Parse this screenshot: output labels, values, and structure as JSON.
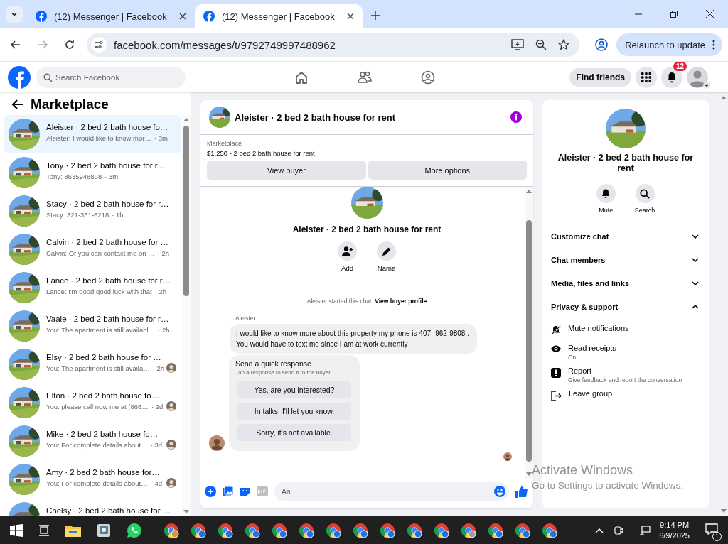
{
  "browser": {
    "tabs": [
      {
        "title": "(12) Messenger | Facebook",
        "selected": false
      },
      {
        "title": "(12) Messenger | Facebook",
        "selected": true
      }
    ],
    "url": "facebook.com/messages/t/9792749997488962",
    "relaunch": "Relaunch to update"
  },
  "header": {
    "search_placeholder": "Search Facebook",
    "find_friends": "Find friends",
    "notification_count": "12"
  },
  "sidebar": {
    "title": "Marketplace",
    "chats": [
      {
        "name": "Aleister · 2 bed 2 bath house fo…",
        "preview": "Aleister: I would like to know mor…",
        "time": "· 3m",
        "selected": true,
        "seen": false
      },
      {
        "name": "Tony · 2 bed 2 bath house for r…",
        "preview": "Tony: 8635948808",
        "time": "· 3m",
        "selected": false,
        "seen": false
      },
      {
        "name": "Stacy · 2 bed 2 bath house for r…",
        "preview": "Stacy: 321-351-6218",
        "time": "· 1h",
        "selected": false,
        "seen": false
      },
      {
        "name": "Calvin · 2 bed 2 bath house for …",
        "preview": "Calvin: Or you can contact me on …",
        "time": "· 2h",
        "selected": false,
        "seen": false
      },
      {
        "name": "Lance · 2 bed 2 bath house for r…",
        "preview": "Lance: I'm good good luck with that",
        "time": "· 2h",
        "selected": false,
        "seen": false
      },
      {
        "name": "Vaale · 2 bed 2 bath house for r…",
        "preview": "You: The apartment is still availabl…",
        "time": "· 2h",
        "selected": false,
        "seen": false
      },
      {
        "name": "Elsy · 2 bed 2 bath house for …",
        "preview": "You: The apartment is still availa…",
        "time": "· 2h",
        "selected": false,
        "seen": true
      },
      {
        "name": "Elton · 2 bed 2 bath house fo…",
        "preview": "You: please call now me at (866…",
        "time": "· 2d",
        "selected": false,
        "seen": true
      },
      {
        "name": "Mike · 2 bed 2 bath house fo…",
        "preview": "You: For complete details about…",
        "time": "· 3d",
        "selected": false,
        "seen": true
      },
      {
        "name": "Amy · 2 bed 2 bath house for…",
        "preview": "You: For complete details about…",
        "time": "· 4d",
        "selected": false,
        "seen": true
      },
      {
        "name": "Chelsy · 2 bed 2 bath house for …",
        "selected": false,
        "seen": false
      }
    ]
  },
  "conversation": {
    "title": "Aleister · 2 bed 2 bath house for rent",
    "listing": {
      "label": "Marketplace",
      "item": "$1,250 - 2 bed 2 bath house for rent",
      "buttons": [
        "View buyer",
        "More options"
      ]
    },
    "intro": {
      "title": "Aleister · 2 bed 2 bath house for rent",
      "actions": [
        {
          "kind": "add",
          "label": "Add"
        },
        {
          "kind": "name",
          "label": "Name"
        }
      ]
    },
    "started": {
      "text": "Aleister started this chat.",
      "link": "View buyer profile"
    },
    "message": {
      "sender": "Aleister",
      "text": "I would like to know more about this property my phone is 407 -962-9808 . You would have to text me since I am at work currently"
    },
    "quick_response": {
      "title": "Send a quick response",
      "subtitle": "Tap a response to send it to the buyer.",
      "options": [
        "Yes, are you interested?",
        "In talks. I'll let you know.",
        "Sorry, it's not available."
      ]
    },
    "composer": {
      "placeholder": "Aa"
    }
  },
  "details": {
    "title": "Aleister · 2 bed 2 bath house for rent",
    "actions": [
      {
        "kind": "mute",
        "label": "Mute"
      },
      {
        "kind": "search",
        "label": "Search"
      }
    ],
    "sections": [
      {
        "label": "Customize chat",
        "expanded": false
      },
      {
        "label": "Chat members",
        "expanded": false
      },
      {
        "label": "Media, files and links",
        "expanded": false
      },
      {
        "label": "Privacy & support",
        "expanded": true
      }
    ],
    "privacy_items": [
      {
        "kind": "mute",
        "label": "Mute notifications"
      },
      {
        "kind": "receipts",
        "label": "Read receipts",
        "sub": "On"
      },
      {
        "kind": "report",
        "label": "Report",
        "sub": "Give feedback and report the conversation"
      },
      {
        "kind": "leave",
        "label": "Leave group"
      }
    ]
  },
  "activation": {
    "title": "Activate Windows",
    "sub": "Go to Settings to activate Windows."
  },
  "taskbar": {
    "time": "9:14 PM",
    "date": "6/9/2025",
    "notifications": "1"
  }
}
